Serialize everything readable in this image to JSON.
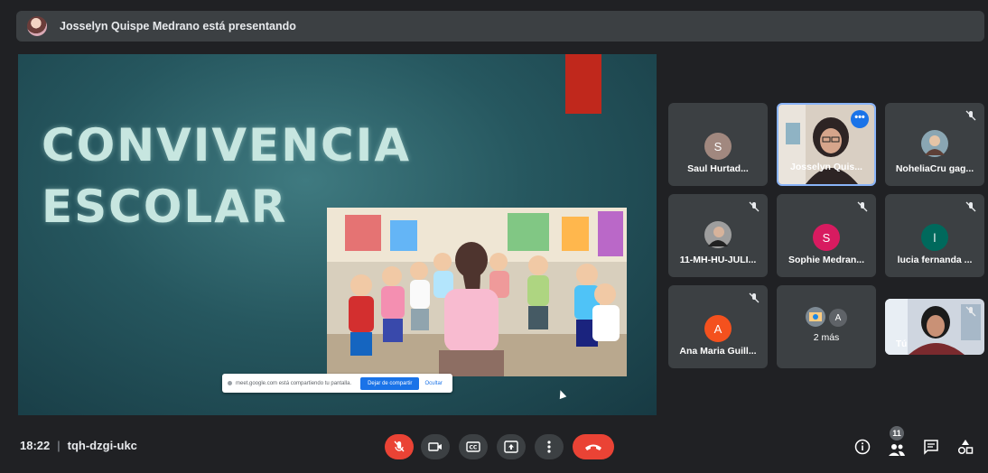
{
  "banner": {
    "presenter_text": "Josselyn Quispe Medrano está presentando"
  },
  "slide": {
    "title_line1": "CONVIVENCIA",
    "title_line2": "ESCOLAR",
    "share_notice": {
      "text": "meet.google.com está compartiendo tu pantalla.",
      "stop_label": "Dejar de compartir",
      "hide_label": "Ocultar"
    }
  },
  "participants": [
    {
      "name": "Saul Hurtad...",
      "initial": "S",
      "color": "#a1887f",
      "muted": false
    },
    {
      "name": "Josselyn Quis...",
      "initial": "",
      "color": "",
      "muted": false,
      "video": true,
      "active": true
    },
    {
      "name": "NoheliaCru gag...",
      "initial": "",
      "color": "",
      "muted": true,
      "photo": true
    },
    {
      "name": "11-MH-HU-JULI...",
      "initial": "",
      "color": "",
      "muted": true,
      "photo": true
    },
    {
      "name": "Sophie Medran...",
      "initial": "S",
      "color": "#d81b60",
      "muted": true
    },
    {
      "name": "lucia fernanda ...",
      "initial": "l",
      "color": "#00695c",
      "muted": true
    },
    {
      "name": "Ana Maria Guill...",
      "initial": "A",
      "color": "#f4511e",
      "muted": true
    },
    {
      "name": "2 más",
      "initial": "A",
      "color": "#5f6368",
      "muted": true
    },
    {
      "name": "Tú",
      "initial": "",
      "color": "",
      "muted": true,
      "video": true
    }
  ],
  "colors": {
    "background": "#202124",
    "tile": "#3c4043",
    "end_call": "#ea4335",
    "accent_blue": "#1a73e8",
    "slide_red": "#c0281c"
  },
  "bottom_bar": {
    "time": "18:22",
    "meeting_code": "tqh-dzgi-ukc",
    "participant_count": "11",
    "icons": [
      "mic-off-icon",
      "camera-icon",
      "captions-icon",
      "present-icon",
      "more-icon",
      "end-call-icon",
      "info-icon",
      "people-icon",
      "chat-icon",
      "activities-icon"
    ]
  }
}
